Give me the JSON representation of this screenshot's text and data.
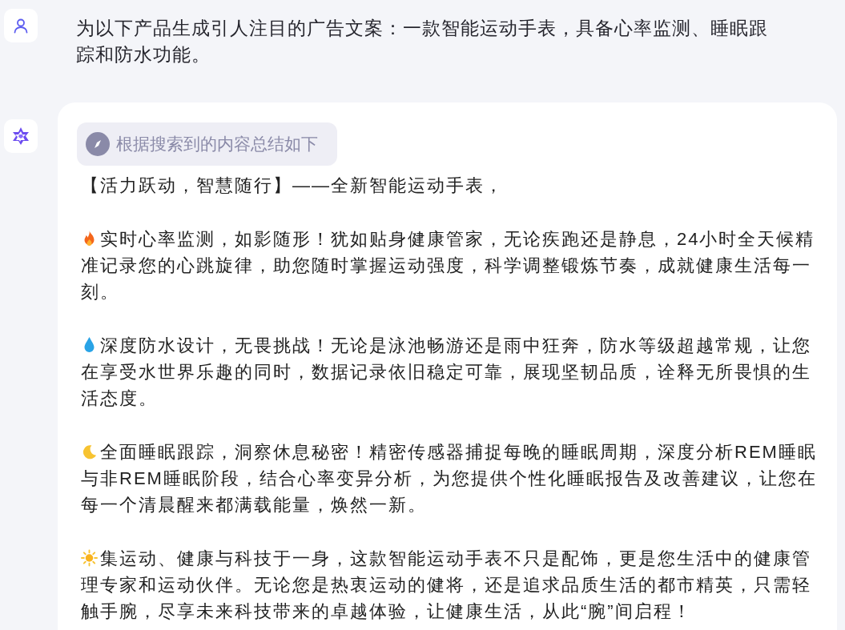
{
  "user_message": {
    "text": "为以下产品生成引人注目的广告文案：一款智能运动手表，具备心率监测、睡眠跟踪和防水功能。"
  },
  "reply": {
    "search_note": "根据搜索到的内容总结如下",
    "paragraphs": [
      {
        "kind": "plain",
        "text": "【活力跃动，智慧随行】——全新智能运动手表，"
      },
      {
        "kind": "fire",
        "text": "实时心率监测，如影随形！犹如贴身健康管家，无论疾跑还是静息，24小时全天候精准记录您的心跳旋律，助您随时掌握运动强度，科学调整锻炼节奏，成就健康生活每一刻。"
      },
      {
        "kind": "droplet",
        "text": "深度防水设计，无畏挑战！无论是泳池畅游还是雨中狂奔，防水等级超越常规，让您在享受水世界乐趣的同时，数据记录依旧稳定可靠，展现坚韧品质，诠释无所畏惧的生活态度。"
      },
      {
        "kind": "moon",
        "text": "全面睡眠跟踪，洞察休息秘密！精密传感器捕捉每晚的睡眠周期，深度分析REM睡眠与非REM睡眠阶段，结合心率变异分析，为您提供个性化睡眠报告及改善建议，让您在每一个清晨醒来都满载能量，焕然一新。"
      },
      {
        "kind": "sun",
        "text": "集运动、健康与科技于一身，这款智能运动手表不只是配饰，更是您生活中的健康管理专家和运动伙伴。无论您是热衷运动的健将，还是追求品质生活的都市精英，只需轻触手腕，尽享未来科技带来的卓越体验，让健康生活，从此“腕”间启程！"
      }
    ]
  }
}
